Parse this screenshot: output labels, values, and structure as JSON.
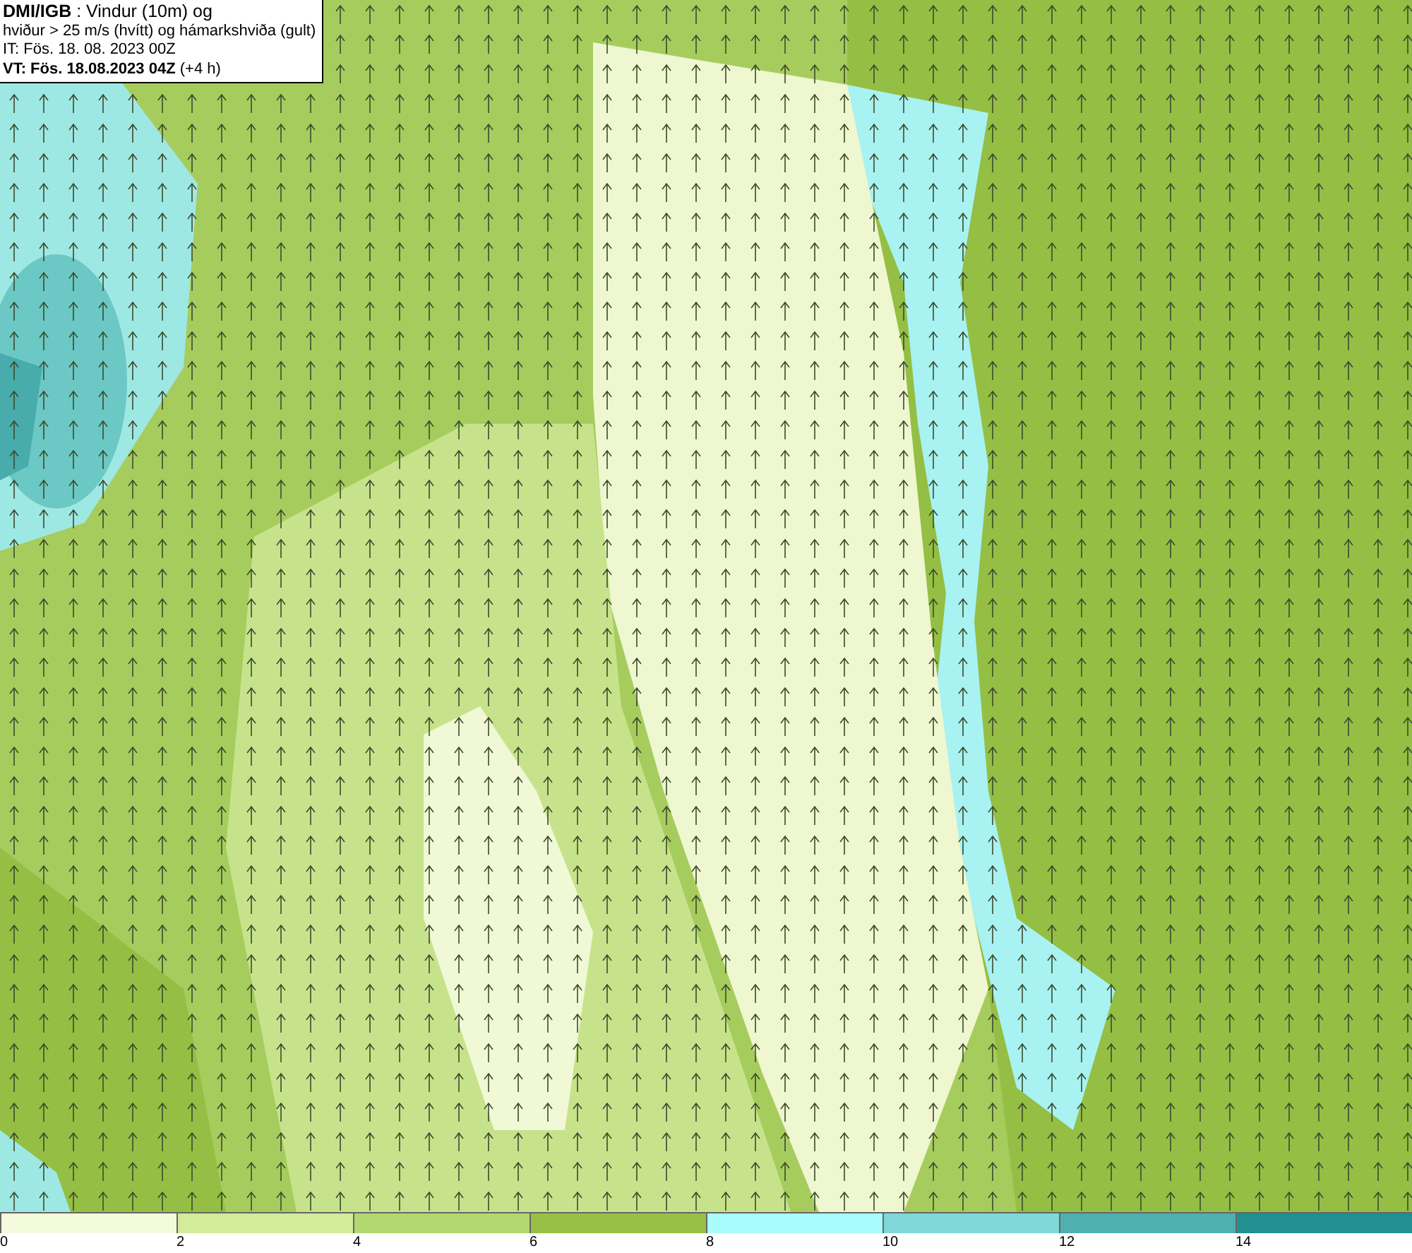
{
  "title_box": {
    "lines": [
      "**DMI/IGB** : Vindur (10m) og",
      "hviður > 25 m/s (hvítt) og hámarkshviða (gult)",
      "IT: Fös. 18. 08. 2023 00Z",
      "**VT: Fös. 18.08.2023 04Z** (+4 h)"
    ]
  },
  "legend": {
    "bins": [
      {
        "label": "0",
        "color": "#f4fbdc"
      },
      {
        "label": "2",
        "color": "#d3ec9a"
      },
      {
        "label": "4",
        "color": "#b4d870"
      },
      {
        "label": "6",
        "color": "#98c046"
      },
      {
        "label": "8",
        "color": "#a8fcfc"
      },
      {
        "label": "10",
        "color": "#80d8d8"
      },
      {
        "label": "12",
        "color": "#50b0b0"
      },
      {
        "label": "14",
        "color": "#209090"
      }
    ]
  }
}
